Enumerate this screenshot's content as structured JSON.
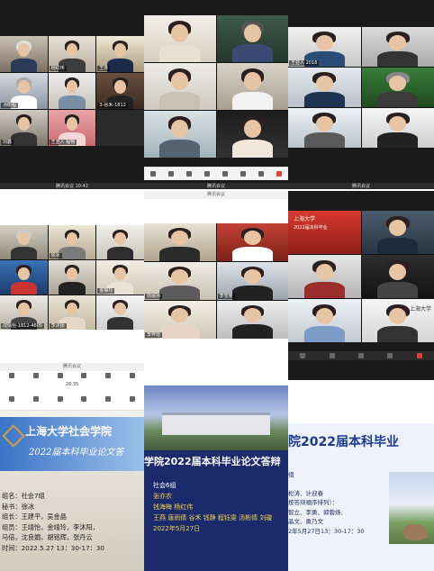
{
  "panels": {
    "p1": {
      "names": [
        "",
        "杨红伟",
        "王赤",
        "汤彬程",
        "",
        "3-谷禾-1812",
        "刘鑫",
        "王亚人 程畅",
        ""
      ],
      "status": "腾讯会议",
      "time": "10:42"
    },
    "p2": {
      "names": [
        "",
        "",
        "",
        "",
        "",
        "",
        "",
        "",
        ""
      ],
      "toolbar": [
        "",
        "",
        "",
        "",
        "",
        "",
        "",
        ""
      ],
      "status": "腾讯会议"
    },
    "p3": {
      "names": [
        "王亚人 2018",
        "",
        "",
        "",
        "",
        "",
        "",
        "",
        ""
      ],
      "status": "腾讯会议"
    },
    "p4": {
      "names": [
        "",
        "徐冰",
        "",
        "",
        "",
        "",
        "",
        "",
        "金静玲",
        "",
        "",
        "",
        "",
        "成佩怡-1812-4605",
        "李沐阳",
        "",
        "",
        ""
      ],
      "status": "腾讯会议"
    },
    "p5": {
      "names": [
        "",
        "",
        "",
        "郭展扬",
        "李雪斐",
        "",
        "李梓瑄",
        "",
        ""
      ],
      "status": "腾讯会议"
    },
    "p6": {
      "names": [
        "",
        "",
        "",
        "",
        "",
        "",
        "",
        "",
        ""
      ],
      "caption": "上海大学",
      "banner_lines": [
        "上海大学",
        "2022届本科毕业"
      ]
    }
  },
  "card1": {
    "status_time": "28:35",
    "title_line1": "上海大学社会学院",
    "title_line2": "2022届本科毕业论文答",
    "info": [
      "组名：社会7组",
      "秘书：徐冰",
      "组长：王建平，吴金晶",
      "组员：王靖怡，金靖玲，李沐阳，",
      "  马倍，沈良娟，胡铭辉，张丹云",
      "时间：2022.5.27  13：30-17：30"
    ]
  },
  "card2": {
    "title": "学院2022届本科毕业论文答辩",
    "group": "社会6组",
    "leader": "张亦农",
    "secretary": "钱海梅 杨红伟",
    "members": "王燕 唐雨倩 谷禾 钱静 程钰雯 汤彬倩 刘璇",
    "date": "2022年5月27日"
  },
  "card3": {
    "title": "院2022届本科毕业",
    "lines": [
      "组",
      "",
      "松涛、计迎春",
      "按答辩顺序排列）：",
      "智立、李勇、郭蓉炀、",
      "晶文、勇乃文",
      "2年5月27日13：30-17：30"
    ]
  },
  "colors": {
    "brand_red": "#c62a2a",
    "dark_blue": "#1b2a6b",
    "card_bg": "#eef2fb"
  }
}
